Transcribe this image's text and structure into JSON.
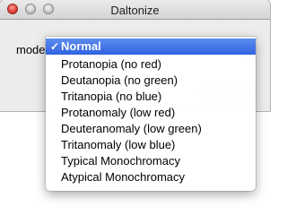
{
  "window": {
    "title": "Daltonize"
  },
  "form": {
    "mode_label": "mode:"
  },
  "menu": {
    "check_glyph": "✓",
    "items": [
      {
        "label": "Normal",
        "selected": true
      },
      {
        "label": "Protanopia (no red)"
      },
      {
        "label": "Deutanopia (no green)"
      },
      {
        "label": "Tritanopia (no blue)"
      },
      {
        "label": "Protanomaly (low red)"
      },
      {
        "label": "Deuteranomaly (low green)"
      },
      {
        "label": "Tritanomaly (low blue)"
      },
      {
        "label": "Typical Monochromacy"
      },
      {
        "label": "Atypical Monochromacy"
      }
    ]
  }
}
